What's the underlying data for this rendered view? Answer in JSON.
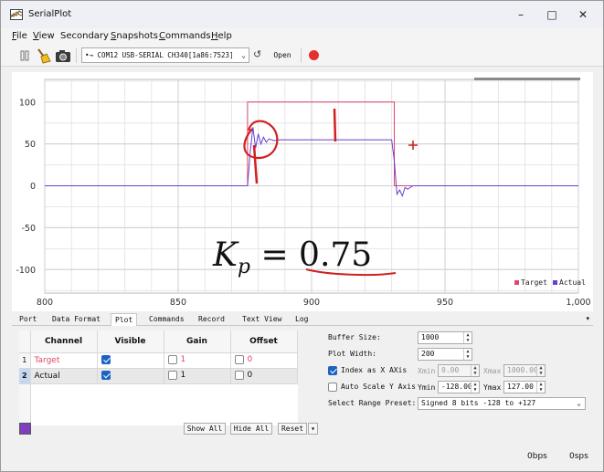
{
  "window": {
    "title": "SerialPlot"
  },
  "menu": [
    {
      "label": "File",
      "u": "F",
      "rest": "ile"
    },
    {
      "label": "View",
      "u": "V",
      "rest": "iew"
    },
    {
      "label": "Secondary",
      "u": "",
      "rest": "Secondary"
    },
    {
      "label": "Snapshots",
      "u": "S",
      "rest": "napshots"
    },
    {
      "label": "Commands",
      "u": "C",
      "rest": "ommands"
    },
    {
      "label": "Help",
      "u": "H",
      "rest": "elp"
    }
  ],
  "toolbar": {
    "port": "COM12 USB-SERIAL CH340[1a86:7523]",
    "refresh_icon": "↺",
    "open_label": "Open"
  },
  "chart_data": {
    "type": "line",
    "xlim": [
      800,
      1000
    ],
    "ylim": [
      -128,
      127
    ],
    "x_ticks": [
      800,
      850,
      900,
      950,
      1000
    ],
    "x_tick_labels": [
      "800",
      "850",
      "900",
      "950",
      "1,000"
    ],
    "y_ticks": [
      100,
      50,
      0,
      -50,
      -100
    ],
    "y_tick_labels": [
      "100",
      "50",
      "0",
      "-50",
      "-100"
    ],
    "grid": true,
    "legend_position": "bottom-right",
    "series": [
      {
        "name": "Target",
        "color": "#e0466a",
        "x": [
          800,
          876,
          876,
          931,
          931,
          1000
        ],
        "y": [
          0,
          0,
          100,
          100,
          0,
          0
        ]
      },
      {
        "name": "Actual",
        "color": "#6a3fd0",
        "x": [
          800,
          876,
          877,
          878,
          879,
          880,
          881,
          882,
          883,
          884,
          886,
          888,
          890,
          895,
          900,
          910,
          920,
          929,
          930,
          931,
          932,
          933,
          934,
          935,
          936,
          938,
          940,
          1000
        ],
        "y": [
          0,
          0,
          40,
          70,
          45,
          62,
          50,
          58,
          52,
          56,
          54,
          55,
          55,
          55,
          55,
          55,
          55,
          55,
          55,
          30,
          -10,
          -5,
          -12,
          -2,
          -4,
          0,
          0,
          0
        ]
      }
    ],
    "annotation": {
      "text_main": "K",
      "text_sub": "p",
      "text_rest": " = 0.75"
    }
  },
  "tabs": [
    "Port",
    "Data Format",
    "Plot",
    "Commands",
    "Record",
    "Text View",
    "Log"
  ],
  "active_tab": "Plot",
  "channels": {
    "headers": [
      "Channel",
      "Visible",
      "Gain",
      "Offset"
    ],
    "rows": [
      {
        "num": "1",
        "name": "Target",
        "gain": "1",
        "offset": "0"
      },
      {
        "num": "2",
        "name": "Actual",
        "gain": "1",
        "offset": "0"
      }
    ]
  },
  "buttons": {
    "show_all": "Show All",
    "hide_all": "Hide All",
    "reset": "Reset"
  },
  "settings": {
    "buffer_size_label": "Buffer Size:",
    "buffer_size": "1000",
    "plot_width_label": "Plot Width:",
    "plot_width": "200",
    "index_x_label": "Index as X AXis",
    "xmin_label": "Xmin",
    "xmin": "0.00",
    "xmax_label": "Xmax",
    "xmax": "1000.00",
    "autoscale_label": "Auto Scale Y Axis",
    "ymin_label": "Ymin",
    "ymin": "-128.00",
    "ymax_label": "Ymax",
    "ymax": "127.00",
    "range_label": "Select Range Preset:",
    "range_value": "Signed 8 bits -128 to +127"
  },
  "status": {
    "rx": "0bps",
    "sps": "0sps"
  },
  "colors": {
    "target": "#e0466a",
    "actual": "#6a3fd0",
    "annotation": "#d02020"
  }
}
